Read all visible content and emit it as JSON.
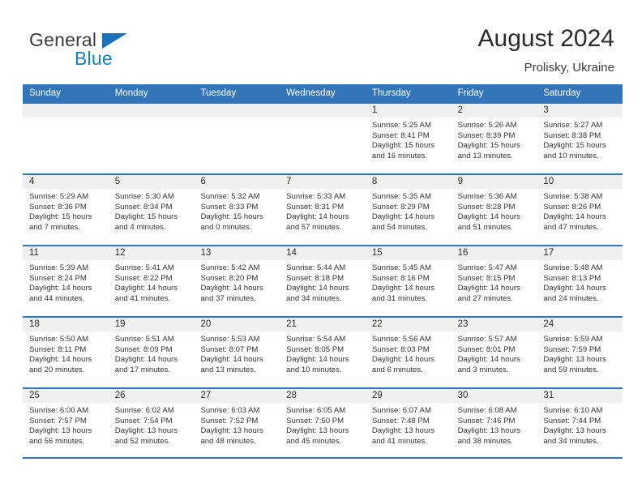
{
  "brand": {
    "word_one": "General",
    "word_two": "Blue",
    "triangle_icon": "triangle-icon",
    "accent_color": "#1481c8",
    "logo_blue": "#1d6fb8"
  },
  "header": {
    "title": "August 2024",
    "subtitle": "Prolisky, Ukraine"
  },
  "theme": {
    "header_bar_color": "#3275b9",
    "day_number_band": "#f0f0f0"
  },
  "weekdays": [
    "Sunday",
    "Monday",
    "Tuesday",
    "Wednesday",
    "Thursday",
    "Friday",
    "Saturday"
  ],
  "weeks": [
    [
      {
        "day": "",
        "sunrise": "",
        "sunset": "",
        "daylight": "",
        "daylight2": ""
      },
      {
        "day": "",
        "sunrise": "",
        "sunset": "",
        "daylight": "",
        "daylight2": ""
      },
      {
        "day": "",
        "sunrise": "",
        "sunset": "",
        "daylight": "",
        "daylight2": ""
      },
      {
        "day": "",
        "sunrise": "",
        "sunset": "",
        "daylight": "",
        "daylight2": ""
      },
      {
        "day": "1",
        "sunrise": "Sunrise: 5:25 AM",
        "sunset": "Sunset: 8:41 PM",
        "daylight": "Daylight: 15 hours",
        "daylight2": "and 16 minutes."
      },
      {
        "day": "2",
        "sunrise": "Sunrise: 5:26 AM",
        "sunset": "Sunset: 8:39 PM",
        "daylight": "Daylight: 15 hours",
        "daylight2": "and 13 minutes."
      },
      {
        "day": "3",
        "sunrise": "Sunrise: 5:27 AM",
        "sunset": "Sunset: 8:38 PM",
        "daylight": "Daylight: 15 hours",
        "daylight2": "and 10 minutes."
      }
    ],
    [
      {
        "day": "4",
        "sunrise": "Sunrise: 5:29 AM",
        "sunset": "Sunset: 8:36 PM",
        "daylight": "Daylight: 15 hours",
        "daylight2": "and 7 minutes."
      },
      {
        "day": "5",
        "sunrise": "Sunrise: 5:30 AM",
        "sunset": "Sunset: 8:34 PM",
        "daylight": "Daylight: 15 hours",
        "daylight2": "and 4 minutes."
      },
      {
        "day": "6",
        "sunrise": "Sunrise: 5:32 AM",
        "sunset": "Sunset: 8:33 PM",
        "daylight": "Daylight: 15 hours",
        "daylight2": "and 0 minutes."
      },
      {
        "day": "7",
        "sunrise": "Sunrise: 5:33 AM",
        "sunset": "Sunset: 8:31 PM",
        "daylight": "Daylight: 14 hours",
        "daylight2": "and 57 minutes."
      },
      {
        "day": "8",
        "sunrise": "Sunrise: 5:35 AM",
        "sunset": "Sunset: 8:29 PM",
        "daylight": "Daylight: 14 hours",
        "daylight2": "and 54 minutes."
      },
      {
        "day": "9",
        "sunrise": "Sunrise: 5:36 AM",
        "sunset": "Sunset: 8:28 PM",
        "daylight": "Daylight: 14 hours",
        "daylight2": "and 51 minutes."
      },
      {
        "day": "10",
        "sunrise": "Sunrise: 5:38 AM",
        "sunset": "Sunset: 8:26 PM",
        "daylight": "Daylight: 14 hours",
        "daylight2": "and 47 minutes."
      }
    ],
    [
      {
        "day": "11",
        "sunrise": "Sunrise: 5:39 AM",
        "sunset": "Sunset: 8:24 PM",
        "daylight": "Daylight: 14 hours",
        "daylight2": "and 44 minutes."
      },
      {
        "day": "12",
        "sunrise": "Sunrise: 5:41 AM",
        "sunset": "Sunset: 8:22 PM",
        "daylight": "Daylight: 14 hours",
        "daylight2": "and 41 minutes."
      },
      {
        "day": "13",
        "sunrise": "Sunrise: 5:42 AM",
        "sunset": "Sunset: 8:20 PM",
        "daylight": "Daylight: 14 hours",
        "daylight2": "and 37 minutes."
      },
      {
        "day": "14",
        "sunrise": "Sunrise: 5:44 AM",
        "sunset": "Sunset: 8:18 PM",
        "daylight": "Daylight: 14 hours",
        "daylight2": "and 34 minutes."
      },
      {
        "day": "15",
        "sunrise": "Sunrise: 5:45 AM",
        "sunset": "Sunset: 8:16 PM",
        "daylight": "Daylight: 14 hours",
        "daylight2": "and 31 minutes."
      },
      {
        "day": "16",
        "sunrise": "Sunrise: 5:47 AM",
        "sunset": "Sunset: 8:15 PM",
        "daylight": "Daylight: 14 hours",
        "daylight2": "and 27 minutes."
      },
      {
        "day": "17",
        "sunrise": "Sunrise: 5:48 AM",
        "sunset": "Sunset: 8:13 PM",
        "daylight": "Daylight: 14 hours",
        "daylight2": "and 24 minutes."
      }
    ],
    [
      {
        "day": "18",
        "sunrise": "Sunrise: 5:50 AM",
        "sunset": "Sunset: 8:11 PM",
        "daylight": "Daylight: 14 hours",
        "daylight2": "and 20 minutes."
      },
      {
        "day": "19",
        "sunrise": "Sunrise: 5:51 AM",
        "sunset": "Sunset: 8:09 PM",
        "daylight": "Daylight: 14 hours",
        "daylight2": "and 17 minutes."
      },
      {
        "day": "20",
        "sunrise": "Sunrise: 5:53 AM",
        "sunset": "Sunset: 8:07 PM",
        "daylight": "Daylight: 14 hours",
        "daylight2": "and 13 minutes."
      },
      {
        "day": "21",
        "sunrise": "Sunrise: 5:54 AM",
        "sunset": "Sunset: 8:05 PM",
        "daylight": "Daylight: 14 hours",
        "daylight2": "and 10 minutes."
      },
      {
        "day": "22",
        "sunrise": "Sunrise: 5:56 AM",
        "sunset": "Sunset: 8:03 PM",
        "daylight": "Daylight: 14 hours",
        "daylight2": "and 6 minutes."
      },
      {
        "day": "23",
        "sunrise": "Sunrise: 5:57 AM",
        "sunset": "Sunset: 8:01 PM",
        "daylight": "Daylight: 14 hours",
        "daylight2": "and 3 minutes."
      },
      {
        "day": "24",
        "sunrise": "Sunrise: 5:59 AM",
        "sunset": "Sunset: 7:59 PM",
        "daylight": "Daylight: 13 hours",
        "daylight2": "and 59 minutes."
      }
    ],
    [
      {
        "day": "25",
        "sunrise": "Sunrise: 6:00 AM",
        "sunset": "Sunset: 7:57 PM",
        "daylight": "Daylight: 13 hours",
        "daylight2": "and 56 minutes."
      },
      {
        "day": "26",
        "sunrise": "Sunrise: 6:02 AM",
        "sunset": "Sunset: 7:54 PM",
        "daylight": "Daylight: 13 hours",
        "daylight2": "and 52 minutes."
      },
      {
        "day": "27",
        "sunrise": "Sunrise: 6:03 AM",
        "sunset": "Sunset: 7:52 PM",
        "daylight": "Daylight: 13 hours",
        "daylight2": "and 48 minutes."
      },
      {
        "day": "28",
        "sunrise": "Sunrise: 6:05 AM",
        "sunset": "Sunset: 7:50 PM",
        "daylight": "Daylight: 13 hours",
        "daylight2": "and 45 minutes."
      },
      {
        "day": "29",
        "sunrise": "Sunrise: 6:07 AM",
        "sunset": "Sunset: 7:48 PM",
        "daylight": "Daylight: 13 hours",
        "daylight2": "and 41 minutes."
      },
      {
        "day": "30",
        "sunrise": "Sunrise: 6:08 AM",
        "sunset": "Sunset: 7:46 PM",
        "daylight": "Daylight: 13 hours",
        "daylight2": "and 38 minutes."
      },
      {
        "day": "31",
        "sunrise": "Sunrise: 6:10 AM",
        "sunset": "Sunset: 7:44 PM",
        "daylight": "Daylight: 13 hours",
        "daylight2": "and 34 minutes."
      }
    ]
  ]
}
